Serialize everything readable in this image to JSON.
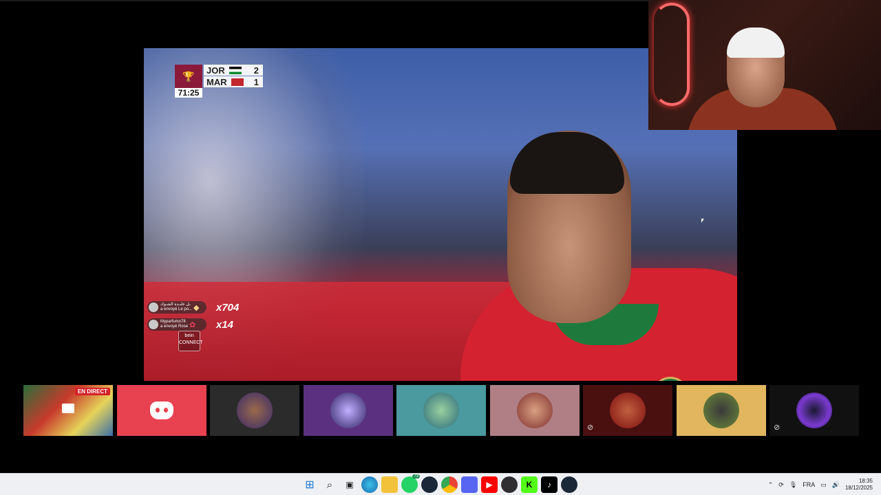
{
  "scoreboard": {
    "team1": "JOR",
    "score1": "2",
    "team2": "MAR",
    "score2": "1",
    "clock": "71:25",
    "logo_icon": "trophy-icon"
  },
  "gifts": [
    {
      "user": "ـل علىـدة الشـوك",
      "sub": "a envoyé Le po...",
      "count": "x704",
      "gift_icon": "diamond-icon"
    },
    {
      "user": "Myparfumo78",
      "sub": "a envoyé Rose",
      "count": "x14",
      "gift_icon": "rose-icon"
    }
  ],
  "bein": {
    "brand": "bein",
    "sub": "CONNECT"
  },
  "participants": [
    {
      "type": "screenshare",
      "live_label": "EN DIRECT",
      "bg": "#2a6e3a"
    },
    {
      "type": "discord",
      "bg": "#e84150"
    },
    {
      "type": "avatar",
      "bg": "#2b2b2b"
    },
    {
      "type": "avatar",
      "bg": "#5b3080"
    },
    {
      "type": "avatar",
      "bg": "#4a9aa0"
    },
    {
      "type": "avatar",
      "bg": "#b07f86"
    },
    {
      "type": "avatar",
      "bg": "#4a1010",
      "muted": true
    },
    {
      "type": "avatar",
      "bg": "#e2b65e"
    },
    {
      "type": "avatar",
      "bg": "#111111",
      "muted": true
    }
  ],
  "taskbar": {
    "icons": [
      "windows-start-icon",
      "search-icon",
      "task-view-icon",
      "edge-icon",
      "file-explorer-icon",
      "whatsapp-icon",
      "steam-icon",
      "chrome-icon",
      "discord-icon",
      "youtube-icon",
      "obs-icon",
      "kick-icon",
      "tiktok-icon",
      "steam-icon"
    ],
    "whatsapp_badge": "73",
    "language": "FRA",
    "time": "18:35",
    "date": "18/12/2025"
  },
  "colors": {
    "accent": "#d42230",
    "discord": "#e84150"
  }
}
